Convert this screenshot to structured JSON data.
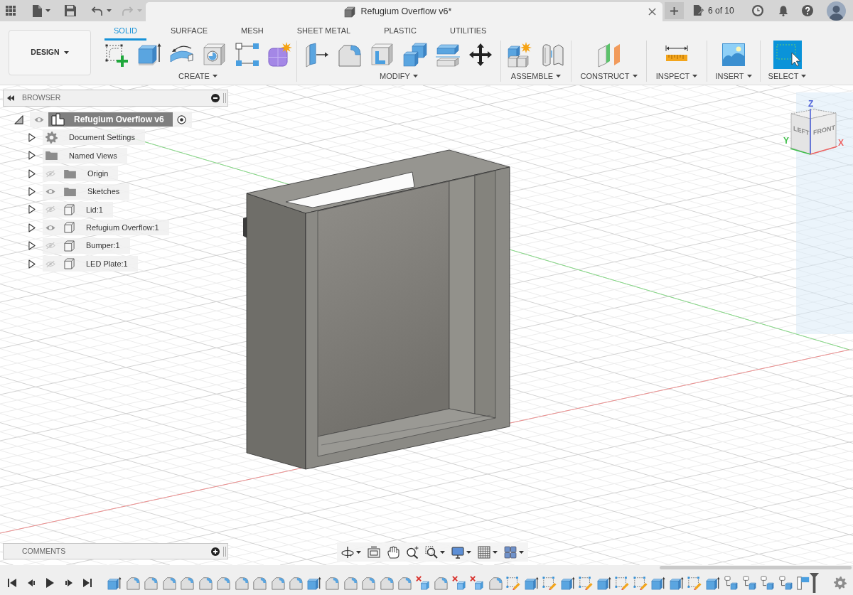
{
  "title_bar": {
    "history": [
      {
        "kind": "undo",
        "disabled": false
      },
      {
        "kind": "redo",
        "disabled": true
      }
    ],
    "document_tab": {
      "title": "Refugium Overflow v6*"
    },
    "jobs": "6 of 10"
  },
  "toolbar": {
    "workspace": "DESIGN",
    "tabs": [
      {
        "label": "SOLID",
        "selected": true
      },
      {
        "label": "SURFACE",
        "selected": false
      },
      {
        "label": "MESH",
        "selected": false
      },
      {
        "label": "SHEET METAL",
        "selected": false
      },
      {
        "label": "PLASTIC",
        "selected": false
      },
      {
        "label": "UTILITIES",
        "selected": false
      }
    ],
    "groups": [
      {
        "label": "CREATE",
        "tools": [
          {
            "kind": "sketch"
          },
          {
            "kind": "extrude"
          },
          {
            "kind": "revolve"
          },
          {
            "kind": "hole"
          },
          {
            "kind": "pattern"
          },
          {
            "kind": "form"
          }
        ]
      },
      {
        "label": "MODIFY",
        "tools": [
          {
            "kind": "press-pull"
          },
          {
            "kind": "fillet"
          },
          {
            "kind": "shell"
          },
          {
            "kind": "combine"
          },
          {
            "kind": "split"
          },
          {
            "kind": "move"
          }
        ]
      },
      {
        "label": "ASSEMBLE",
        "tools": [
          {
            "kind": "new-component"
          },
          {
            "kind": "joint"
          }
        ]
      },
      {
        "label": "CONSTRUCT",
        "tools": [
          {
            "kind": "offset-plane"
          }
        ]
      },
      {
        "label": "INSPECT",
        "tools": [
          {
            "kind": "measure"
          }
        ]
      },
      {
        "label": "INSERT",
        "tools": [
          {
            "kind": "insert-image"
          }
        ]
      },
      {
        "label": "SELECT",
        "tools": [
          {
            "kind": "select"
          }
        ]
      }
    ]
  },
  "browser": {
    "title": "BROWSER",
    "root": {
      "label": "Refugium Overflow v6",
      "kind": "component",
      "expanded": true,
      "visible": true,
      "active": true,
      "children": [
        {
          "label": "Document Settings",
          "kind": "settings",
          "expanded": false
        },
        {
          "label": "Named Views",
          "kind": "views",
          "expanded": false
        },
        {
          "label": "Origin",
          "kind": "folder",
          "visible": false,
          "expanded": false
        },
        {
          "label": "Sketches",
          "kind": "folder",
          "visible": true,
          "expanded": false
        },
        {
          "label": "Lid:1",
          "kind": "body",
          "visible": false,
          "expanded": false
        },
        {
          "label": "Refugium Overflow:1",
          "kind": "body",
          "visible": true,
          "expanded": false
        },
        {
          "label": "Bumper:1",
          "kind": "body",
          "visible": false,
          "expanded": false
        },
        {
          "label": "LED Plate:1",
          "kind": "body",
          "visible": false,
          "expanded": false
        }
      ]
    }
  },
  "viewport": {
    "view_cube": {
      "faces": [
        {
          "label": "LEFT"
        },
        {
          "label": "FRONT"
        }
      ],
      "axes": [
        {
          "label": "Z",
          "color": "#4f63d8"
        },
        {
          "label": "Y",
          "color": "#3fbf4a"
        },
        {
          "label": "X",
          "color": "#ee6464"
        }
      ]
    }
  },
  "comments": {
    "title": "COMMENTS"
  },
  "navigation_bar": {
    "tools": [
      {
        "kind": "orbit",
        "menu": true
      },
      {
        "kind": "look-at",
        "menu": false
      },
      {
        "kind": "pan",
        "menu": false
      },
      {
        "kind": "zoom",
        "menu": false
      },
      {
        "kind": "fit",
        "menu": true
      },
      {
        "kind": "display",
        "menu": true
      },
      {
        "kind": "grid",
        "menu": true
      },
      {
        "kind": "viewports",
        "menu": true
      }
    ]
  },
  "timeline": {
    "controls": [
      {
        "kind": "first"
      },
      {
        "kind": "previous"
      },
      {
        "kind": "play"
      },
      {
        "kind": "next"
      },
      {
        "kind": "last"
      }
    ],
    "features": [
      {
        "kind": "extrude"
      },
      {
        "kind": "fillet"
      },
      {
        "kind": "fillet"
      },
      {
        "kind": "fillet"
      },
      {
        "kind": "fillet"
      },
      {
        "kind": "fillet"
      },
      {
        "kind": "fillet"
      },
      {
        "kind": "fillet"
      },
      {
        "kind": "fillet"
      },
      {
        "kind": "fillet"
      },
      {
        "kind": "fillet"
      },
      {
        "kind": "extrude"
      },
      {
        "kind": "fillet"
      },
      {
        "kind": "fillet"
      },
      {
        "kind": "fillet"
      },
      {
        "kind": "fillet"
      },
      {
        "kind": "fillet"
      },
      {
        "kind": "delete"
      },
      {
        "kind": "fillet"
      },
      {
        "kind": "delete"
      },
      {
        "kind": "delete"
      },
      {
        "kind": "fillet"
      },
      {
        "kind": "sketch"
      },
      {
        "kind": "extrude"
      },
      {
        "kind": "sketch"
      },
      {
        "kind": "extrude"
      },
      {
        "kind": "sketch"
      },
      {
        "kind": "extrude"
      },
      {
        "kind": "sketch"
      },
      {
        "kind": "sketch"
      },
      {
        "kind": "extrude"
      },
      {
        "kind": "extrude"
      },
      {
        "kind": "sketch"
      },
      {
        "kind": "extrude"
      },
      {
        "kind": "component"
      },
      {
        "kind": "component"
      },
      {
        "kind": "component"
      },
      {
        "kind": "component"
      },
      {
        "kind": "flag"
      }
    ]
  }
}
